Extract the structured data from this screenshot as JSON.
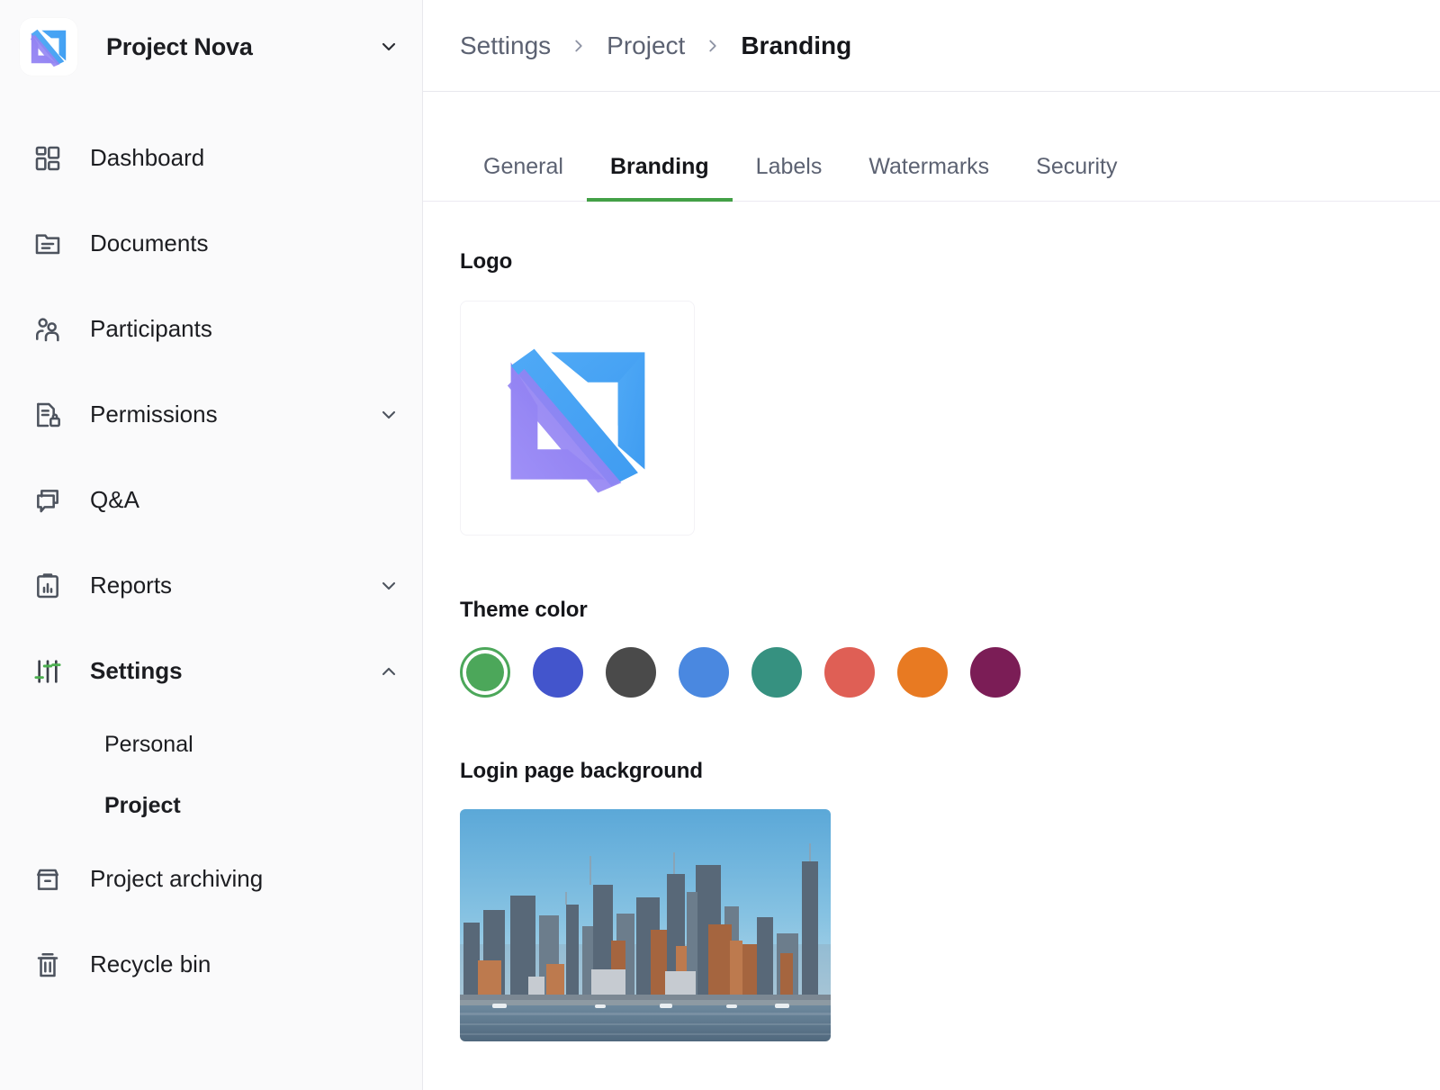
{
  "sidebar": {
    "brand": {
      "name": "Project Nova",
      "caret_icon": "chevron-down-icon",
      "logo_icon": "nova-logo-icon"
    },
    "items": [
      {
        "label": "Dashboard",
        "icon": "dashboard-grid-icon",
        "expandable": false,
        "active": false
      },
      {
        "label": "Documents",
        "icon": "document-folder-icon",
        "expandable": false,
        "active": false
      },
      {
        "label": "Participants",
        "icon": "participants-people-icon",
        "expandable": false,
        "active": false
      },
      {
        "label": "Permissions",
        "icon": "permissions-lock-document-icon",
        "expandable": true,
        "expanded": false,
        "active": false
      },
      {
        "label": "Q&A",
        "icon": "qa-chat-bubbles-icon",
        "expandable": false,
        "active": false
      },
      {
        "label": "Reports",
        "icon": "reports-clipboard-chart-icon",
        "expandable": true,
        "expanded": false,
        "active": false
      },
      {
        "label": "Settings",
        "icon": "settings-sliders-icon",
        "expandable": true,
        "expanded": true,
        "active": true
      },
      {
        "label": "Project archiving",
        "icon": "archive-box-icon",
        "expandable": false,
        "active": false
      },
      {
        "label": "Recycle bin",
        "icon": "trash-bin-icon",
        "expandable": false,
        "active": false
      }
    ],
    "settings_subitems": [
      {
        "label": "Personal",
        "active": false
      },
      {
        "label": "Project",
        "active": true
      }
    ]
  },
  "breadcrumb": {
    "items": [
      "Settings",
      "Project",
      "Branding"
    ],
    "separator_icon": "chevron-right-icon"
  },
  "tabs": [
    {
      "label": "General",
      "active": false
    },
    {
      "label": "Branding",
      "active": true
    },
    {
      "label": "Labels",
      "active": false
    },
    {
      "label": "Watermarks",
      "active": false
    },
    {
      "label": "Security",
      "active": false
    }
  ],
  "sections": {
    "logo": {
      "title": "Logo",
      "preview_icon": "nova-logo-icon"
    },
    "theme_color": {
      "title": "Theme color",
      "selected_index": 0,
      "swatches": [
        {
          "name": "green",
          "hex": "#4ca75a",
          "selected": true
        },
        {
          "name": "indigo",
          "hex": "#4355cc",
          "selected": false
        },
        {
          "name": "dark-gray",
          "hex": "#4a4a4a",
          "selected": false
        },
        {
          "name": "blue",
          "hex": "#4a88e0",
          "selected": false
        },
        {
          "name": "teal",
          "hex": "#369180",
          "selected": false
        },
        {
          "name": "red",
          "hex": "#df5f55",
          "selected": false
        },
        {
          "name": "orange",
          "hex": "#e87a22",
          "selected": false
        },
        {
          "name": "plum",
          "hex": "#7b1d56",
          "selected": false
        }
      ]
    },
    "login_background": {
      "title": "Login page background",
      "image_description": "city-skyline-photo"
    }
  },
  "colors": {
    "accent_green": "#43a047",
    "sidebar_bg": "#fafafb",
    "border": "#e8e8ed",
    "text_primary": "#15161a",
    "text_muted": "#5c6272",
    "logo_purple": "#8b7cf0",
    "logo_blue": "#4aa6f5"
  }
}
